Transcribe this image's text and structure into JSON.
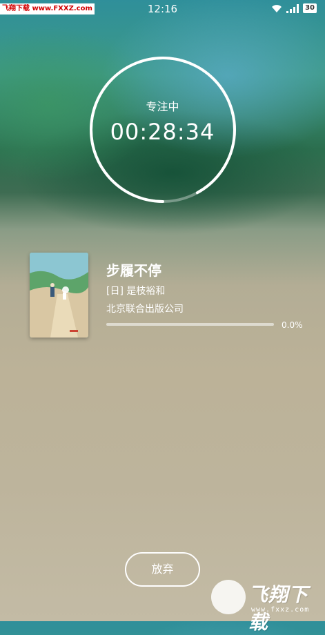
{
  "status_bar": {
    "watermark_text": "飞翔下载 www.FXXZ.com",
    "time": "12:16",
    "battery": "30",
    "icons": [
      "wifi-icon",
      "signal-icon",
      "battery-icon"
    ]
  },
  "timer": {
    "label": "专注中",
    "value": "00:28:34",
    "ring_progress": 0.92
  },
  "book": {
    "title": "步履不停",
    "author": "[日] 是枝裕和",
    "publisher": "北京联合出版公司",
    "progress_text": "0.0%",
    "progress_value": 0.0
  },
  "actions": {
    "give_up_label": "放弃"
  },
  "watermark": {
    "brand": "飞翔下载",
    "url": "www.fxxz.com"
  }
}
